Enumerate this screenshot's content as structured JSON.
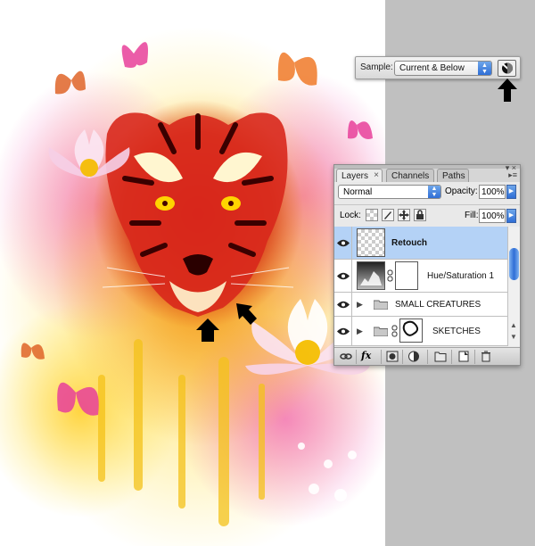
{
  "sample_bar": {
    "label": "Sample:",
    "value": "Current & Below",
    "adjustment_icon": "ignore-adjustment-layers-icon"
  },
  "layers_panel": {
    "tabs": [
      {
        "label": "Layers",
        "close": "×"
      },
      {
        "label": "Channels"
      },
      {
        "label": "Paths"
      }
    ],
    "blend_mode": "Normal",
    "opacity_label": "Opacity:",
    "opacity_value": "100%",
    "lock_label": "Lock:",
    "fill_label": "Fill:",
    "fill_value": "100%",
    "layers": [
      {
        "name": "Retouch",
        "selected": true
      },
      {
        "name": "Hue/Saturation 1",
        "selected": false
      },
      {
        "name": "SMALL CREATURES",
        "selected": false
      },
      {
        "name": "SKETCHES",
        "selected": false
      }
    ],
    "bottom_icons": [
      "link-layers-icon",
      "fx-icon",
      "layer-mask-icon",
      "adjustment-layer-icon",
      "new-group-icon",
      "new-layer-icon",
      "trash-icon"
    ],
    "fx_label": "fx"
  },
  "colors": {
    "selection": "#b4d2f6",
    "accent_blue": "#2f6ed6",
    "canvas_gray": "#c0c0c0"
  }
}
